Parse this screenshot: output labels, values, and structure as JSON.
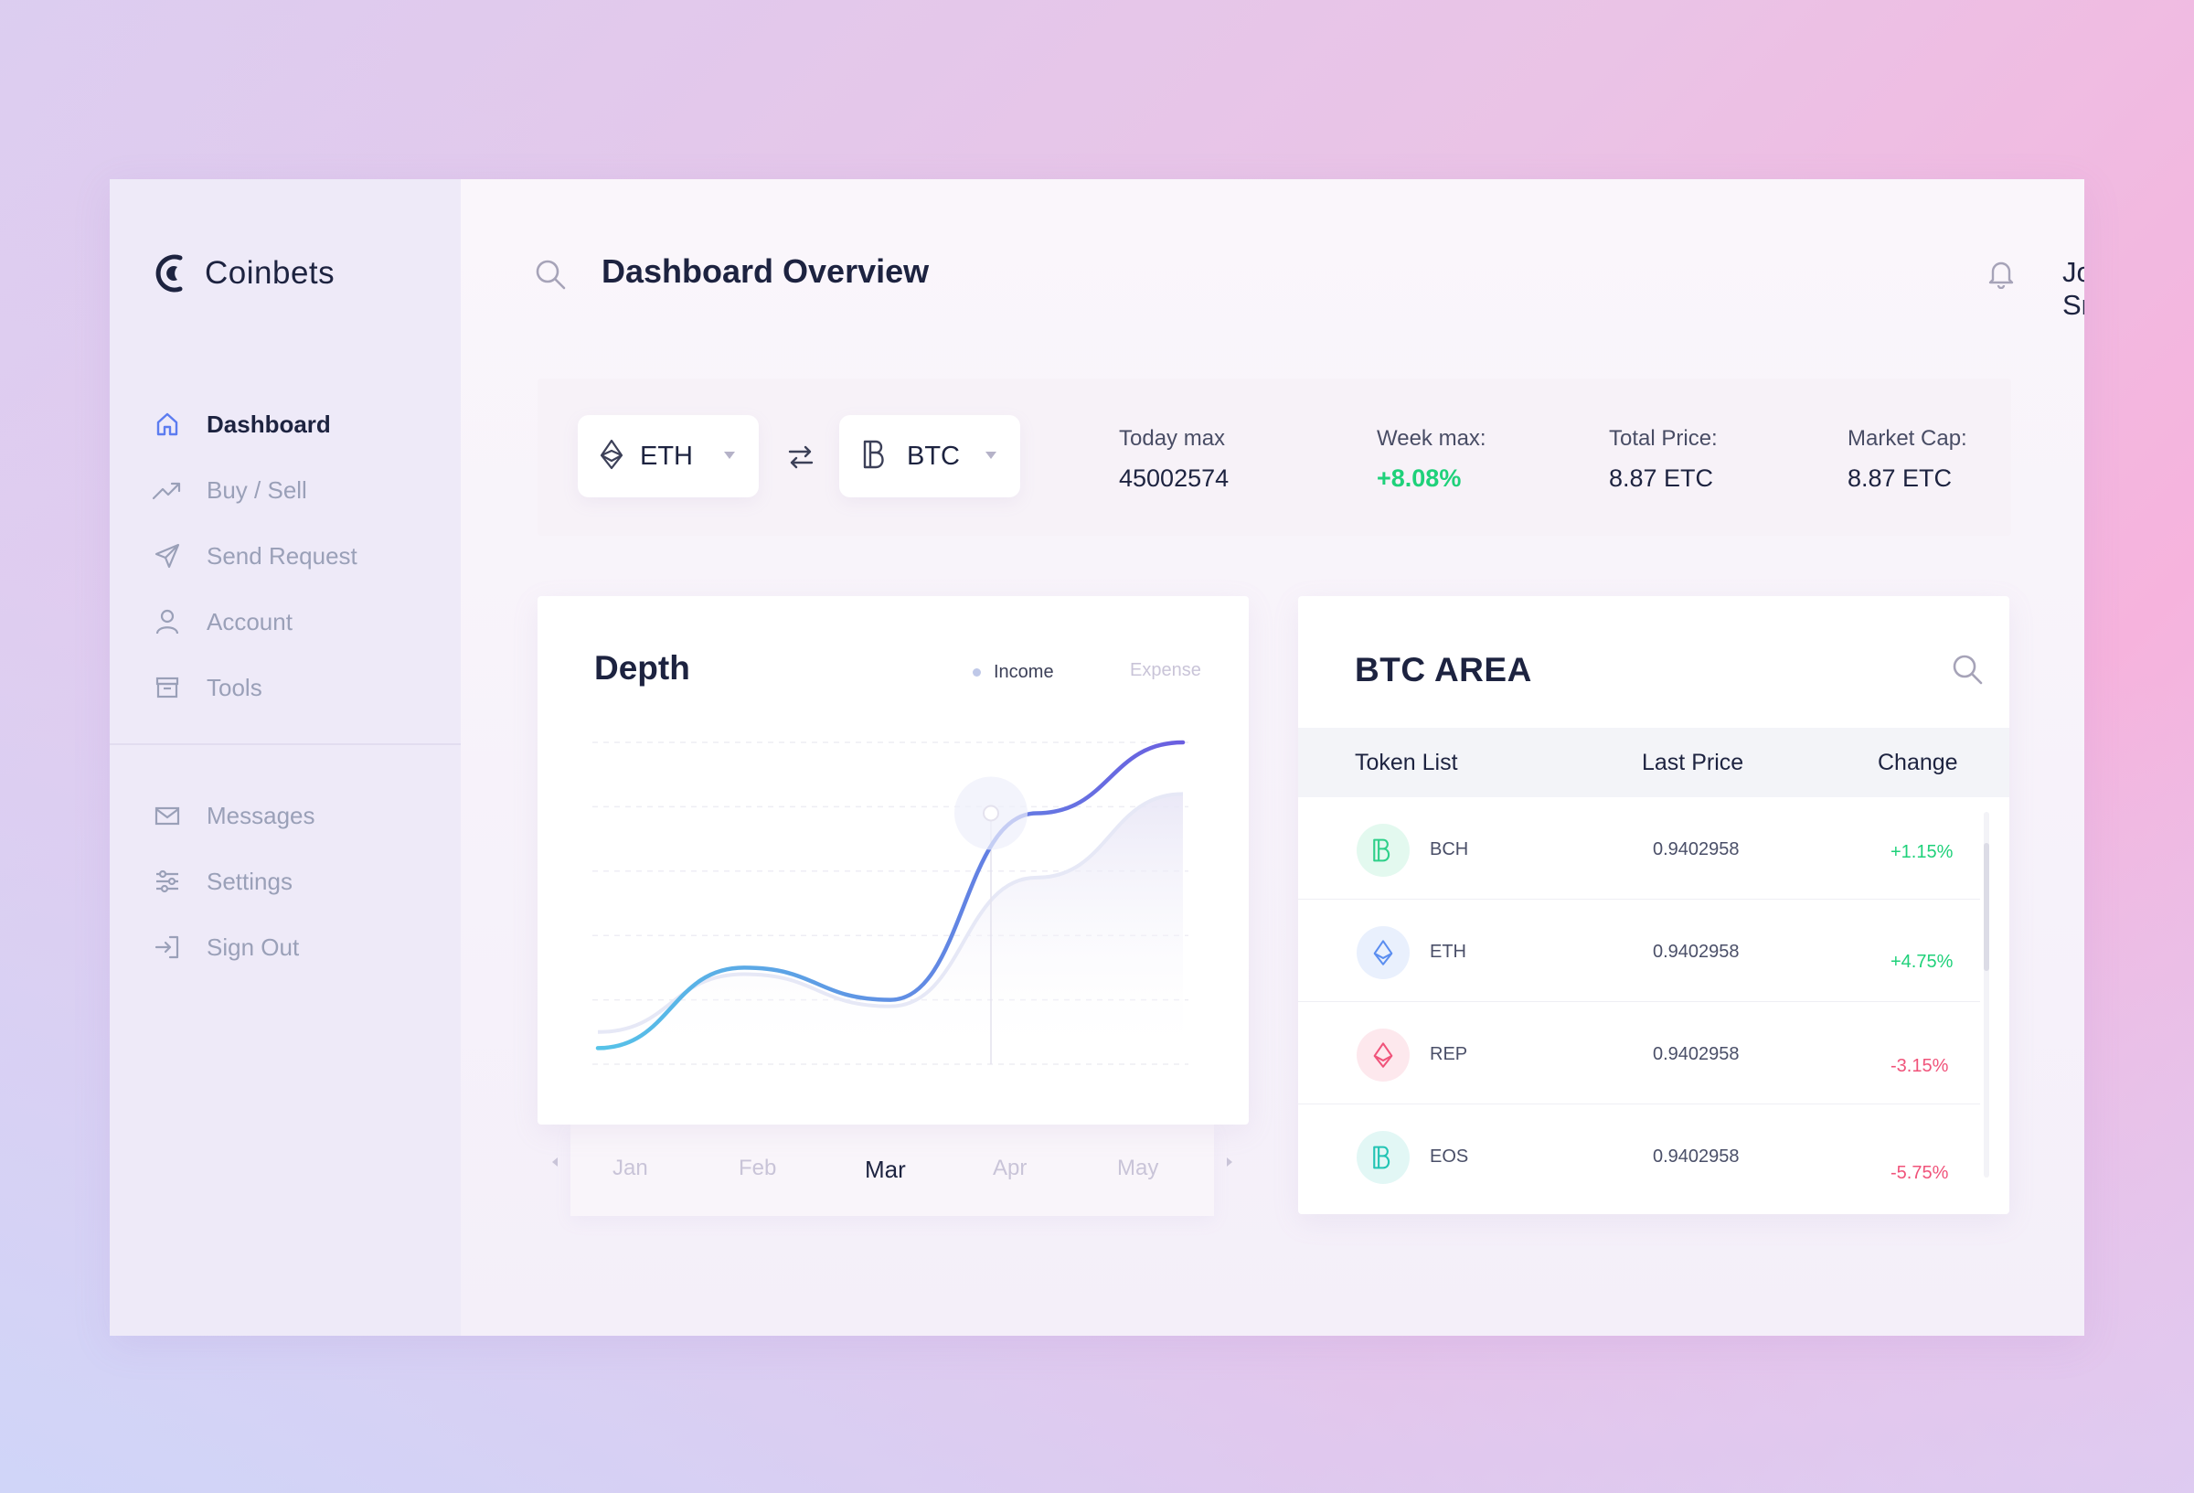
{
  "app": {
    "name": "Coinbets"
  },
  "sidebar": {
    "items": [
      {
        "label": "Dashboard",
        "icon": "home-icon",
        "active": true
      },
      {
        "label": "Buy / Sell",
        "icon": "trending-up-icon",
        "active": false
      },
      {
        "label": "Send Request",
        "icon": "send-icon",
        "active": false
      },
      {
        "label": "Account",
        "icon": "user-icon",
        "active": false
      },
      {
        "label": "Tools",
        "icon": "archive-icon",
        "active": false
      }
    ],
    "secondary": [
      {
        "label": "Messages",
        "icon": "mail-icon"
      },
      {
        "label": "Settings",
        "icon": "sliders-icon"
      },
      {
        "label": "Sign Out",
        "icon": "sign-out-icon"
      }
    ]
  },
  "header": {
    "title": "Dashboard Overview",
    "user_name": "John Smith"
  },
  "ticker": {
    "from_coin": "ETH",
    "to_coin": "BTC",
    "stats": [
      {
        "label": "Today max",
        "value": "45002574"
      },
      {
        "label": "Week max:",
        "value": "+8.08%"
      },
      {
        "label": "Total Price:",
        "value": "8.87 ETC"
      },
      {
        "label": "Market Cap:",
        "value": "8.87 ETC"
      }
    ]
  },
  "depth": {
    "title": "Depth",
    "legend_income": "Income",
    "legend_expense": "Expense",
    "months": [
      "Jan",
      "Feb",
      "Mar",
      "Apr",
      "May"
    ],
    "selected_month": "Mar"
  },
  "btc_area": {
    "title": "BTC AREA",
    "columns": [
      "Token List",
      "Last Price",
      "Change"
    ],
    "rows": [
      {
        "token": "BCH",
        "price": "0.9402958",
        "change": "+1.15%",
        "direction": "up",
        "icon": "bcoin-icon",
        "color": "#2fd08a"
      },
      {
        "token": "ETH",
        "price": "0.9402958",
        "change": "+4.75%",
        "direction": "up",
        "icon": "ethereum-icon",
        "color": "#5b8ef0"
      },
      {
        "token": "REP",
        "price": "0.9402958",
        "change": "-3.15%",
        "direction": "down",
        "icon": "ethereum-icon",
        "color": "#f0537a"
      },
      {
        "token": "EOS",
        "price": "0.9402958",
        "change": "-5.75%",
        "direction": "down",
        "icon": "bcoin-icon",
        "color": "#22c4b4"
      }
    ]
  },
  "chart_data": {
    "type": "line",
    "categories": [
      "Jan",
      "Feb",
      "Mar",
      "Apr",
      "May"
    ],
    "series": [
      {
        "name": "Income",
        "values": [
          5,
          30,
          20,
          78,
          100
        ]
      },
      {
        "name": "Expense",
        "values": [
          10,
          28,
          18,
          58,
          84
        ]
      }
    ],
    "title": "Depth",
    "ylim": [
      0,
      100
    ]
  },
  "colors": {
    "accent": "#5c6ee8",
    "positive": "#1fd17a",
    "negative": "#f0537a",
    "text_dark": "#1d2340"
  }
}
